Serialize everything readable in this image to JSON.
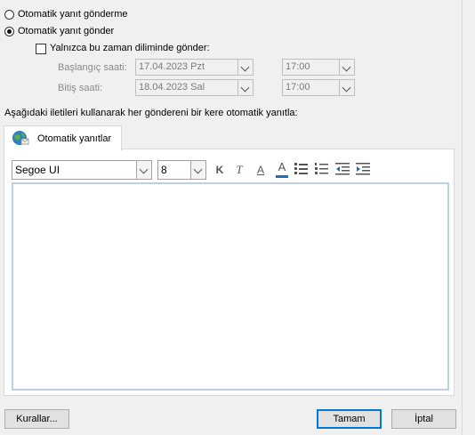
{
  "options": {
    "no_auto_reply": "Otomatik yanıt gönderme",
    "send_auto_reply": "Otomatik yanıt gönder",
    "only_time_range": "Yalnızca bu zaman diliminde gönder:"
  },
  "schedule": {
    "start_label": "Başlangıç saati:",
    "start_date": "17.04.2023 Pzt",
    "start_time": "17:00",
    "end_label": "Bitiş saati:",
    "end_date": "18.04.2023 Sal",
    "end_time": "17:00"
  },
  "instruction": "Aşağıdaki iletileri kullanarak her göndereni bir kere otomatik yanıtla:",
  "tab": {
    "label": "Otomatik yanıtlar"
  },
  "toolbar": {
    "font": "Segoe UI",
    "size": "8",
    "bold": "K",
    "italic": "T",
    "underline": "A",
    "font_color": "A",
    "accent_color": "#1f6fb8"
  },
  "buttons": {
    "rules": "Kurallar...",
    "ok": "Tamam",
    "cancel": "İptal"
  }
}
